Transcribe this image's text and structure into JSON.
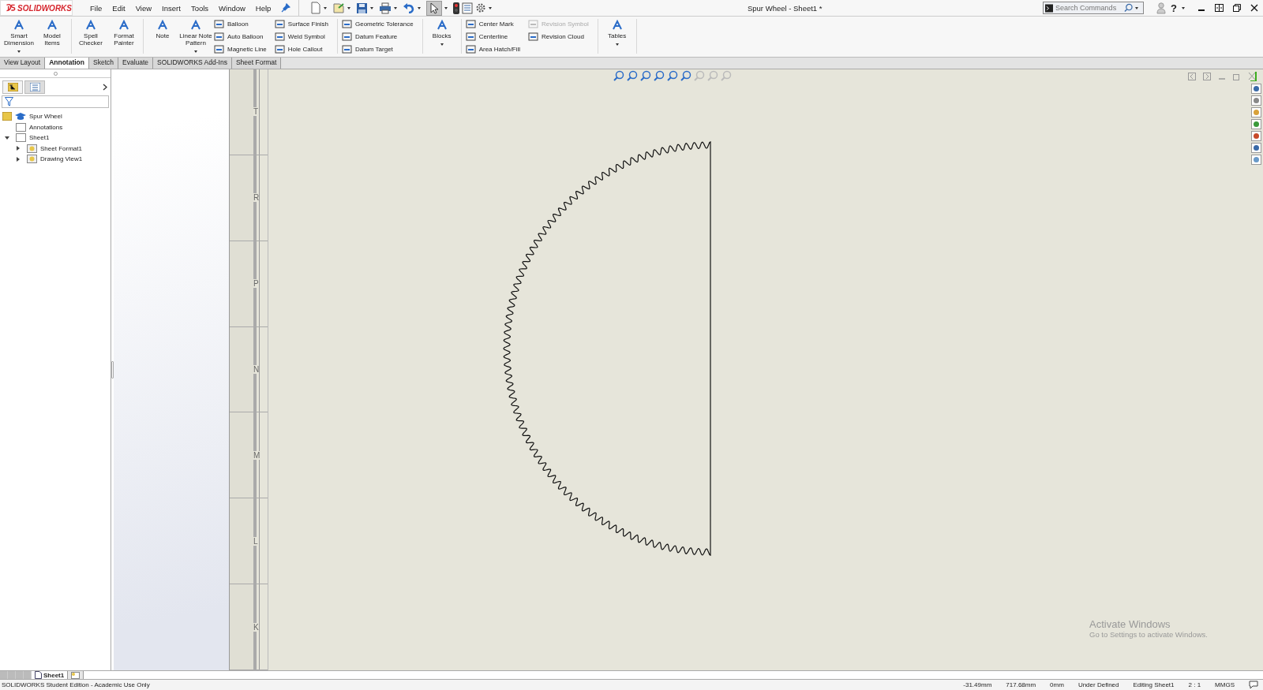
{
  "app": {
    "logo": "SOLIDWORKS",
    "menu": [
      {
        "label": "File"
      },
      {
        "label": "Edit"
      },
      {
        "label": "View"
      },
      {
        "label": "Insert"
      },
      {
        "label": "Tools"
      },
      {
        "label": "Window"
      },
      {
        "label": "Help"
      }
    ],
    "title": "Spur Wheel - Sheet1 *",
    "search": {
      "placeholder": "Search Commands"
    },
    "help": "?"
  },
  "ribbon": {
    "groups": [
      {
        "items": [
          {
            "kind": "large",
            "label": "Smart Dimension",
            "dropdown": true
          },
          {
            "kind": "large",
            "label": "Model Items",
            "dropdown": false
          }
        ]
      },
      {
        "items": [
          {
            "kind": "large",
            "label": "Spell Checker",
            "dropdown": false
          },
          {
            "kind": "large",
            "label": "Format Painter",
            "dropdown": false
          }
        ]
      },
      {
        "items": [
          {
            "kind": "large",
            "label": "Note",
            "dropdown": false
          },
          {
            "kind": "large",
            "label": "Linear Note Pattern",
            "dropdown": true
          },
          {
            "kind": "column",
            "items": [
              {
                "label": "Balloon",
                "disabled": false
              },
              {
                "label": "Auto Balloon",
                "disabled": false
              },
              {
                "label": "Magnetic Line",
                "disabled": false
              }
            ]
          },
          {
            "kind": "column",
            "items": [
              {
                "label": "Surface Finish",
                "disabled": false
              },
              {
                "label": "Weld Symbol",
                "disabled": false
              },
              {
                "label": "Hole Callout",
                "disabled": false
              }
            ]
          }
        ]
      },
      {
        "items": [
          {
            "kind": "column",
            "items": [
              {
                "label": "Geometric Tolerance",
                "disabled": false
              },
              {
                "label": "Datum Feature",
                "disabled": false
              },
              {
                "label": "Datum Target",
                "disabled": false
              }
            ]
          }
        ]
      },
      {
        "items": [
          {
            "kind": "large",
            "label": "Blocks",
            "dropdown": true
          }
        ]
      },
      {
        "items": [
          {
            "kind": "column",
            "items": [
              {
                "label": "Center Mark",
                "disabled": false
              },
              {
                "label": "Centerline",
                "disabled": false
              },
              {
                "label": "Area Hatch/Fill",
                "disabled": false
              }
            ]
          },
          {
            "kind": "column",
            "items": [
              {
                "label": "Revision Symbol",
                "disabled": true
              },
              {
                "label": "Revision Cloud",
                "disabled": false
              }
            ]
          }
        ]
      },
      {
        "items": [
          {
            "kind": "large",
            "label": "Tables",
            "dropdown": true
          }
        ]
      }
    ]
  },
  "tabs": [
    {
      "label": "View Layout",
      "selected": false
    },
    {
      "label": "Annotation",
      "selected": true
    },
    {
      "label": "Sketch",
      "selected": false
    },
    {
      "label": "Evaluate",
      "selected": false
    },
    {
      "label": "SOLIDWORKS Add-Ins",
      "selected": false
    },
    {
      "label": "Sheet Format",
      "selected": false
    }
  ],
  "tree": {
    "label": "Spur Wheel",
    "children": [
      {
        "label": "Annotations"
      },
      {
        "label": "Sheet1",
        "expanded": true,
        "children": [
          {
            "label": "Sheet Format1",
            "expanded": false
          },
          {
            "label": "Drawing View1",
            "expanded": false
          }
        ]
      }
    ]
  },
  "ruler": {
    "labels": [
      "T",
      "R",
      "P",
      "N",
      "M",
      "L",
      "K"
    ]
  },
  "watermark": {
    "title": "Activate Windows",
    "text": "Go to Settings to activate Windows."
  },
  "sheet_tabs": [
    {
      "label": "Sheet1",
      "selected": true
    }
  ],
  "status_bar": {
    "text": "SOLIDWORKS Student Edition - Academic Use Only",
    "fields": [
      "-31.49mm",
      "717.68mm",
      "0mm",
      "Under Defined",
      "Editing Sheet1",
      "2 : 1",
      "MMGS"
    ]
  }
}
